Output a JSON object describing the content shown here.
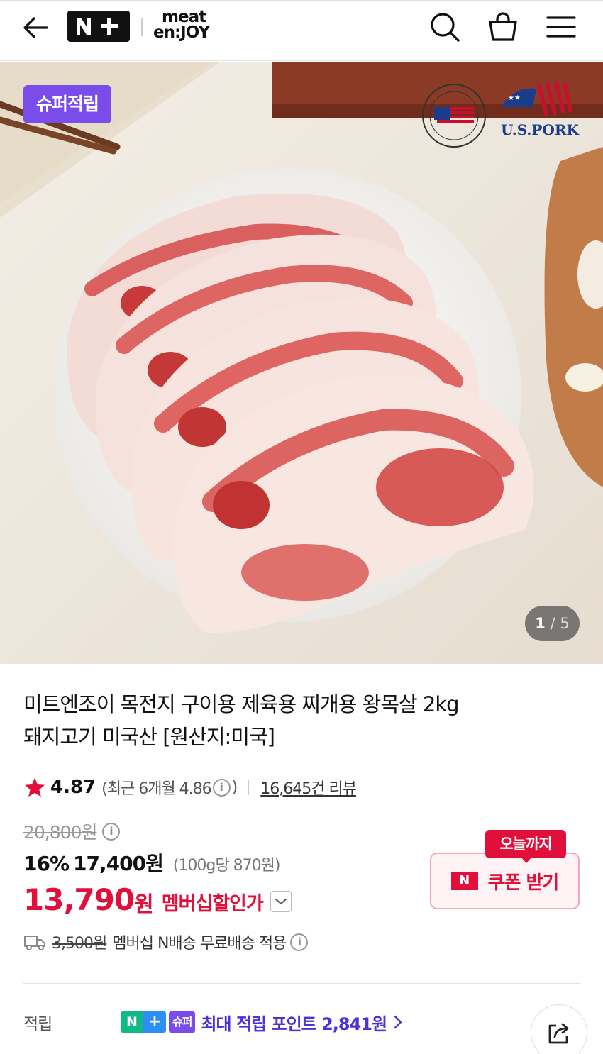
{
  "header": {
    "nplus_logo_text": "N+",
    "meat_logo_line1": "meat",
    "meat_logo_line2": "en:JOY"
  },
  "hero": {
    "badge": "슈퍼적립",
    "brand_logo_text": "U.S.PORK",
    "image_index": "1",
    "image_total": "5"
  },
  "product": {
    "title_line1": "미트엔조이 목전지 구이용 제육용 찌개용 왕목살 2kg",
    "title_line2": "돼지고기 미국산 [원산지:미국]",
    "rating": "4.87",
    "rating_recent_prefix": "(최근 6개월 4.86",
    "rating_recent_suffix": ")",
    "reviews": "16,645건 리뷰",
    "original_price": "20,800원",
    "discount_rate": "16%",
    "sale_price": "17,400원",
    "unit_price": "(100g당 870원)",
    "member_price": "13,790",
    "member_price_unit": "원",
    "member_price_label": "멤버십할인가"
  },
  "coupon": {
    "tag": "오늘까지",
    "n_mark": "N",
    "label": "쿠폰 받기"
  },
  "shipping": {
    "original_fee": "3,500원",
    "text": "멤버십 N배송 무료배송 적용"
  },
  "points": {
    "label": "적립",
    "badge_n": "N",
    "badge_plus": "+",
    "badge_super": "슈퍼",
    "text": "최대 적립 포인트 2,841원"
  },
  "colors": {
    "accent_red": "#e0103a",
    "super_purple": "#7a4dea",
    "point_blue": "#4a34d8"
  }
}
